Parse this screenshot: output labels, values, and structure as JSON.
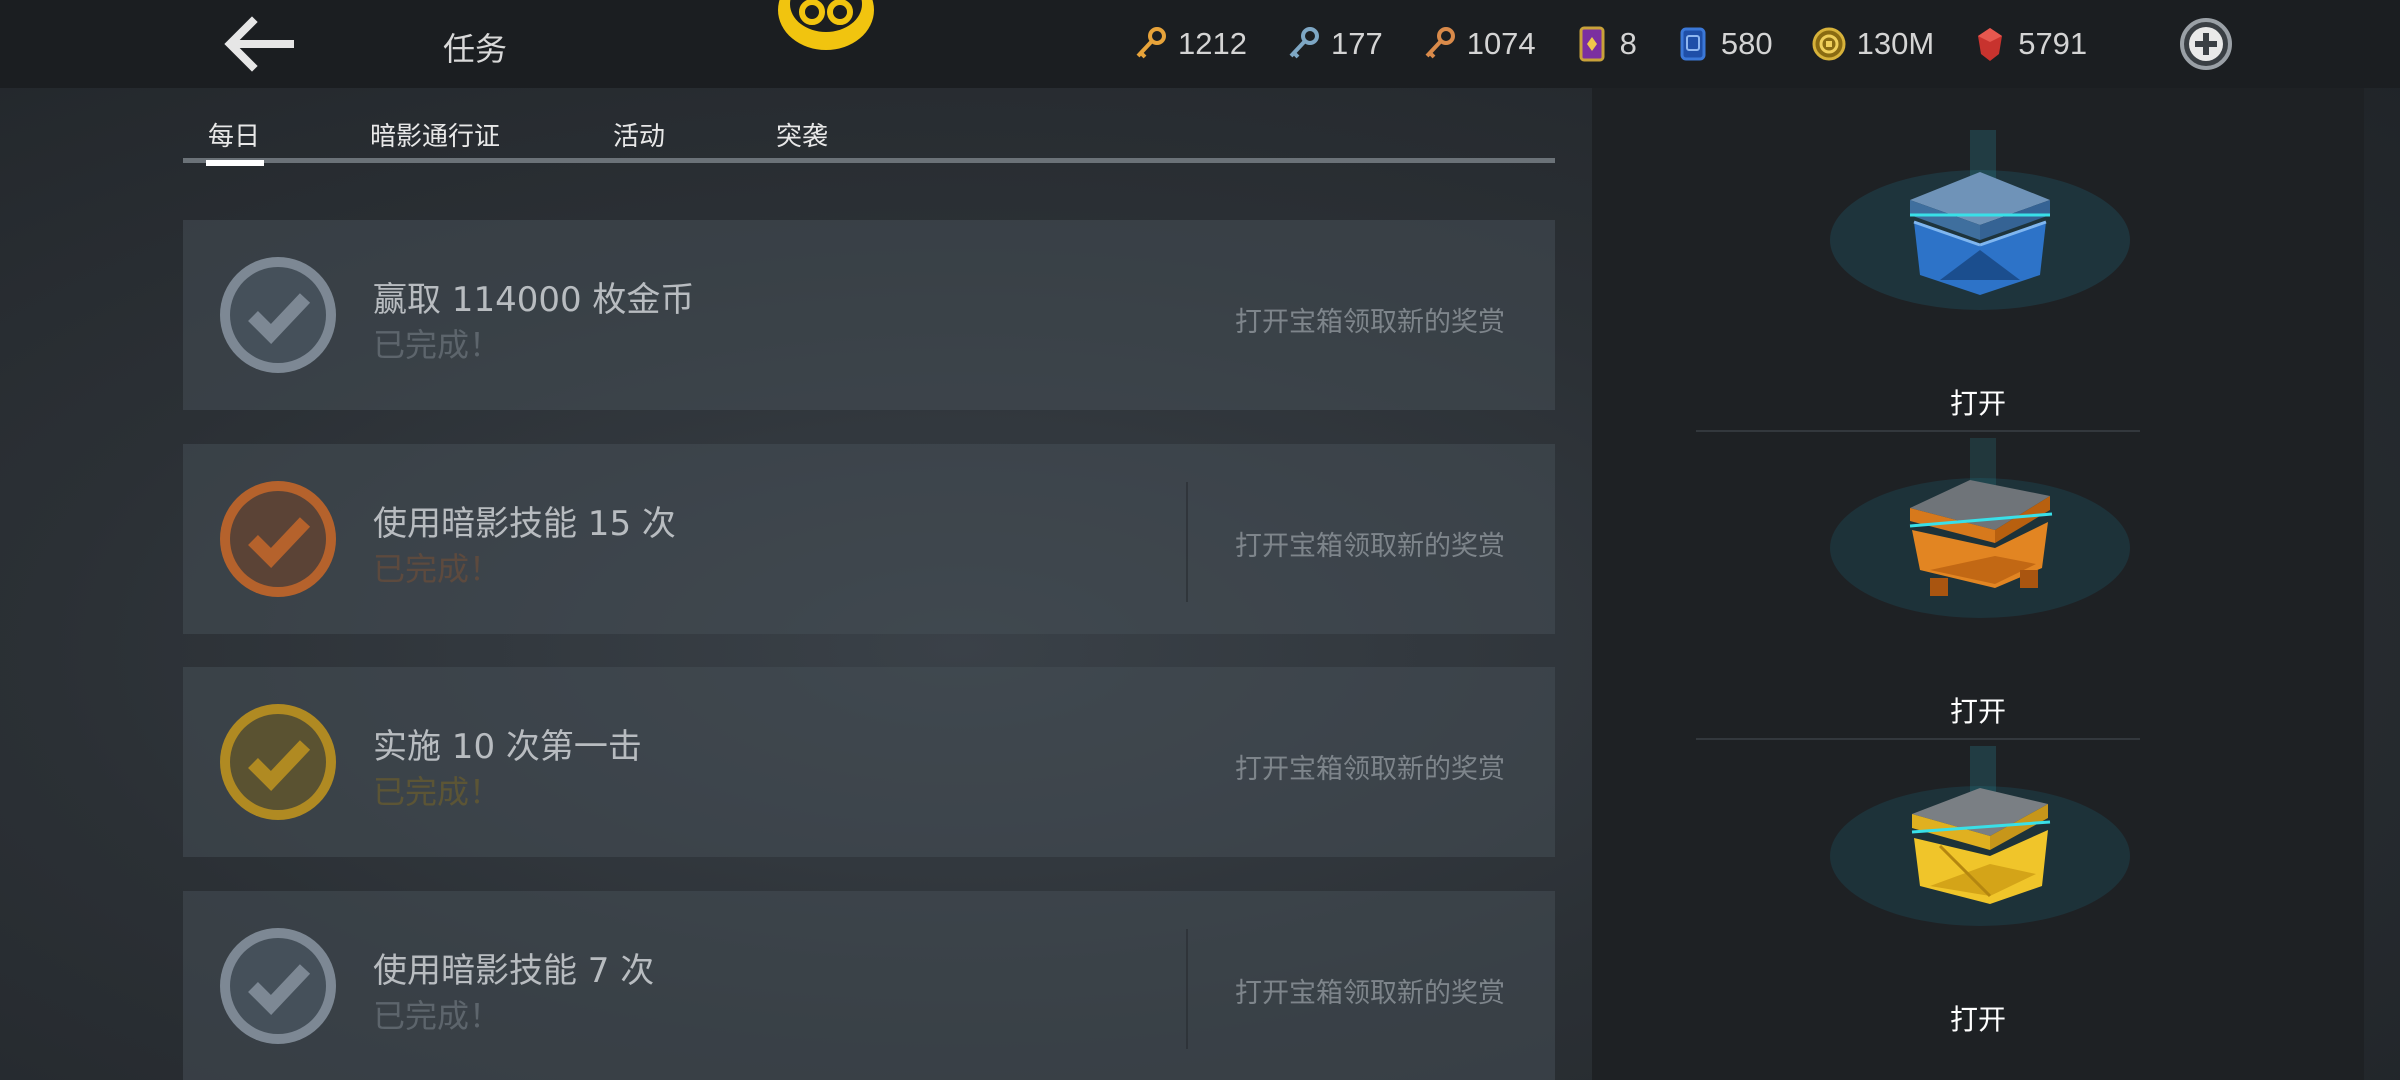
{
  "header": {
    "title": "任务",
    "currencies": [
      {
        "icon": "gold-key-icon",
        "value": "1212",
        "color": "#e7a33a"
      },
      {
        "icon": "silver-key-icon",
        "value": "177",
        "color": "#7ea7c4"
      },
      {
        "icon": "bronze-key-icon",
        "value": "1074",
        "color": "#d98a4a"
      },
      {
        "icon": "ticket-icon",
        "value": "8",
        "color": "#c9a23a"
      },
      {
        "icon": "blue-card-icon",
        "value": "580",
        "color": "#3b78d8"
      },
      {
        "icon": "gold-coin-icon",
        "value": "130M",
        "color": "#d7b23a"
      },
      {
        "icon": "red-gem-icon",
        "value": "5791",
        "color": "#c8332e"
      }
    ]
  },
  "tabs": [
    {
      "label": "每日",
      "active": true
    },
    {
      "label": "暗影通行证",
      "active": false
    },
    {
      "label": "活动",
      "active": false
    },
    {
      "label": "突袭",
      "active": false
    }
  ],
  "tasks": [
    {
      "name": "赢取 114000 枚金币",
      "status": "已完成！",
      "hint": "打开宝箱领取新的奖赏",
      "tier": "silver"
    },
    {
      "name": "使用暗影技能 15 次",
      "status": "已完成！",
      "hint": "打开宝箱领取新的奖赏",
      "tier": "bronze"
    },
    {
      "name": "实施 10 次第一击",
      "status": "已完成！",
      "hint": "打开宝箱领取新的奖赏",
      "tier": "gold"
    },
    {
      "name": "使用暗影技能 7 次",
      "status": "已完成！",
      "hint": "打开宝箱领取新的奖赏",
      "tier": "silver"
    }
  ],
  "chests": [
    {
      "label": "打开",
      "tier": "blue"
    },
    {
      "label": "打开",
      "tier": "orange"
    },
    {
      "label": "打开",
      "tier": "gold"
    }
  ],
  "colors": {
    "silver": "#7d8894",
    "bronze": "#b5622c",
    "gold": "#b08a22",
    "accent_white": "#ffffff"
  }
}
